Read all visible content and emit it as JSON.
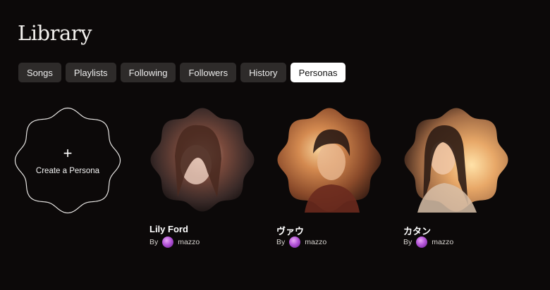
{
  "page": {
    "title": "Library"
  },
  "tabs": [
    {
      "label": "Songs",
      "active": false
    },
    {
      "label": "Playlists",
      "active": false
    },
    {
      "label": "Following",
      "active": false
    },
    {
      "label": "Followers",
      "active": false
    },
    {
      "label": "History",
      "active": false
    },
    {
      "label": "Personas",
      "active": true
    }
  ],
  "create": {
    "icon": "plus-icon",
    "plus": "+",
    "label": "Create a Persona"
  },
  "personas": [
    {
      "name": "Lily Ford",
      "by": "By",
      "author": "mazzo",
      "palette": [
        "#3a2a28",
        "#7a4a3c",
        "#1a1414"
      ]
    },
    {
      "name": "ヴァウ",
      "by": "By",
      "author": "mazzo",
      "palette": [
        "#e0a060",
        "#8a4a2a",
        "#3a1e14"
      ]
    },
    {
      "name": "カタン",
      "by": "By",
      "author": "mazzo",
      "palette": [
        "#f2c688",
        "#b67a48",
        "#4a2e20"
      ]
    }
  ]
}
